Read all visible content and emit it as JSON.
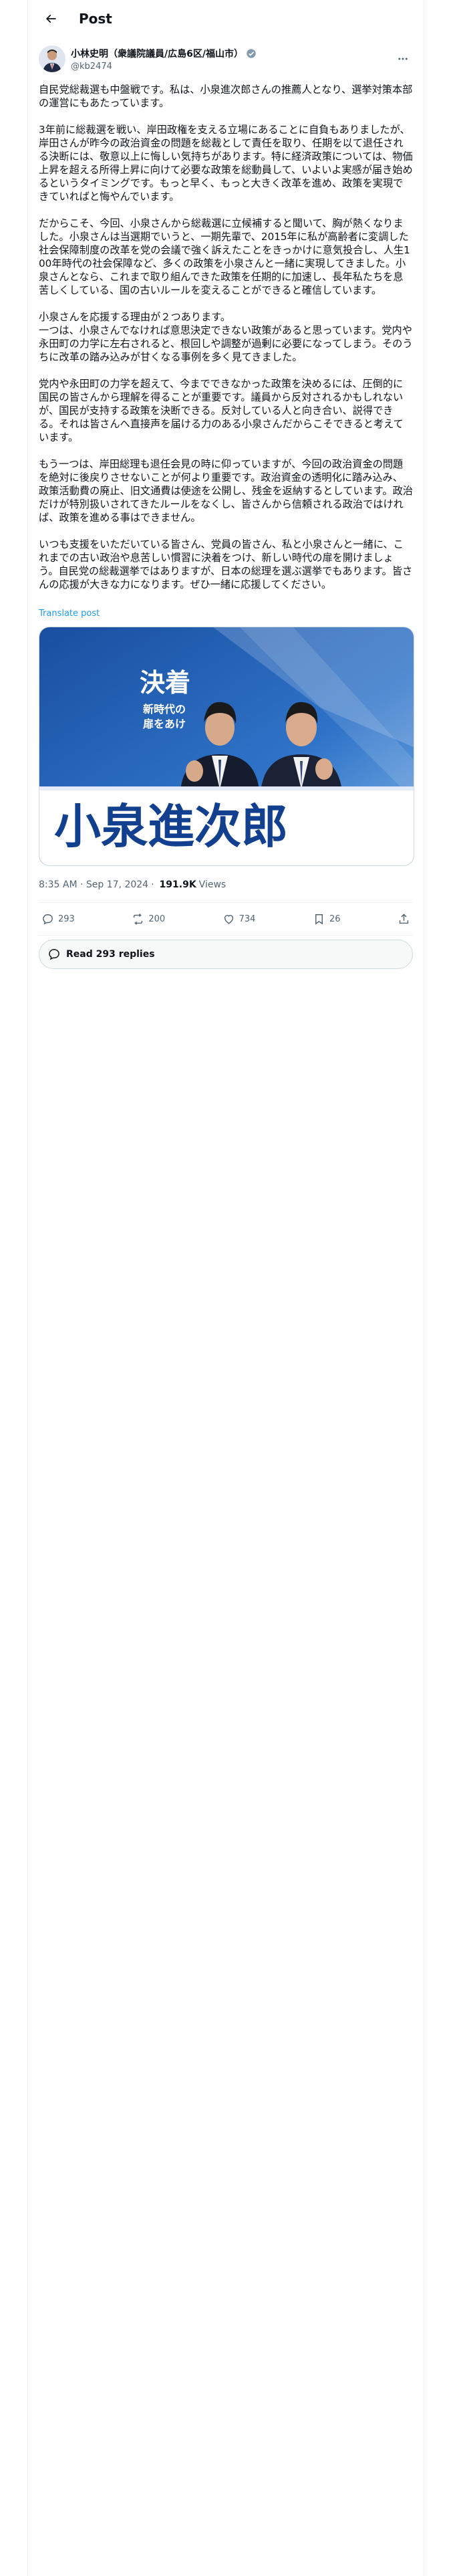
{
  "header": {
    "title": "Post"
  },
  "author": {
    "name": "小林史明（衆議院議員/広島6区/福山市）",
    "handle": "@kb2474"
  },
  "tweet": {
    "paragraphs": [
      "自民党総裁選も中盤戦です。私は、小泉進次郎さんの推薦人となり、選挙対策本部の運営にもあたっています。",
      "3年前に総裁選を戦い、岸田政権を支える立場にあることに自負もありましたが、岸田さんが昨今の政治資金の問題を総裁として責任を取り、任期を以て退任される決断には、敬意以上に悔しい気持ちがあります。特に経済政策については、物価上昇を超える所得上昇に向けて必要な政策を総動員して、いよいよ実感が届き始めるというタイミングです。もっと早く、もっと大きく改革を進め、政策を実現できていればと悔やんでいます。",
      "だからこそ、今回、小泉さんから総裁選に立候補すると聞いて、胸が熱くなりました。小泉さんは当選期でいうと、一期先輩で、2015年に私が高齢者に変調した社会保障制度の改革を党の会議で強く訴えたことをきっかけに意気投合し、人生100年時代の社会保障など、多くの政策を小泉さんと一緒に実現してきました。小泉さんとなら、これまで取り組んできた政策を任期的に加速し、長年私たちを息苦しくしている、国の古いルールを変えることができると確信しています。",
      "小泉さんを応援する理由が２つあります。\n一つは、小泉さんでなければ意思決定できない政策があると思っています。党内や永田町の力学に左右されると、根回しや調整が過剰に必要になってしまう。そのうちに改革の踏み込みが甘くなる事例を多く見てきました。",
      "党内や永田町の力学を超えて、今までできなかった政策を決めるには、圧倒的に国民の皆さんから理解を得ることが重要です。議員から反対されるかもしれないが、国民が支持する政策を決断できる。反対している人と向き合い、説得できる。それは皆さんへ直接声を届ける力のある小泉さんだからこそできると考えています。",
      "もう一つは、岸田総理も退任会見の時に仰っていますが、今回の政治資金の問題を絶対に後戻りさせないことが何より重要です。政治資金の透明化に踏み込み、政策活動費の廃止、旧文通費は使途を公開し、残金を返納するとしています。政治だけが特別扱いされてきたルールをなくし、皆さんから信頼される政治ではければ、政策を進める事はできません。",
      "いつも支援をいただいている皆さん、党員の皆さん、私と小泉さんと一緒に、これまでの古い政治や息苦しい慣習に決着をつけ、新しい時代の扉を開けましょう。自民党の総裁選挙ではありますが、日本の総理を選ぶ選挙でもあります。皆さんの応援が大きな力になります。ぜひ一緒に応援してください。"
    ],
    "translate_label": "Translate post",
    "media": {
      "banner_headline": "決着",
      "banner_sub1": "新時代の",
      "banner_sub2": "扉をあけ",
      "podium_name": "小泉進次郎"
    },
    "timestamp": "8:35 AM · Sep 17, 2024",
    "views_count": "191.9K",
    "views_label": "Views",
    "stats": {
      "replies": "293",
      "reposts": "200",
      "likes": "734",
      "bookmarks": "26"
    },
    "read_replies_label": "Read 293 replies"
  },
  "colors": {
    "accent": "#1d9bf0",
    "secondary_text": "#536471",
    "banner_blue": "#1a4fa0"
  }
}
